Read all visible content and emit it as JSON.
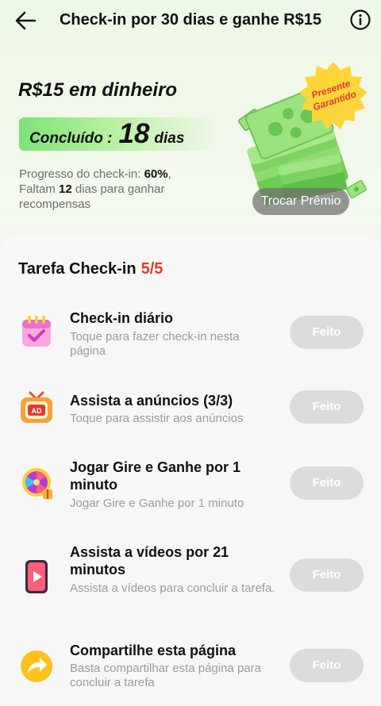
{
  "header": {
    "title": "Check-in por 30 dias e ganhe R$15"
  },
  "hero": {
    "title": "R$15 em dinheiro",
    "done_label": "Concluído :",
    "done_days": "18",
    "done_unit": "dias",
    "progress_label": "Progresso do check-in: ",
    "progress_value": "60%",
    "remaining_prefix": "Faltam ",
    "remaining_days": "12",
    "remaining_suffix": " dias para ganhar recompensas",
    "badge_line1": "Presente",
    "badge_line2": "Garantido",
    "swap_button": "Trocar Prêmio"
  },
  "tasks_section": {
    "title": "Tarefa Check-in",
    "count": "5/5",
    "tasks": [
      {
        "name": "Check-in diário",
        "desc": "Toque para fazer check-in nesta página",
        "button": "Feito",
        "icon": "calendar-icon"
      },
      {
        "name": "Assista a anúncios  (3/3)",
        "desc": "Toque para assistir aos anúncios",
        "button": "Feito",
        "icon": "tv-ad-icon"
      },
      {
        "name": "Jogar Gire e Ganhe por 1 minuto",
        "desc": "Jogar Gire e Ganhe por 1 minuto",
        "button": "Feito",
        "icon": "prize-wheel-icon"
      },
      {
        "name": "Assista a vídeos por 21 minutos",
        "desc": "Assista a vídeos para concluir a tarefa.",
        "button": "Feito",
        "icon": "video-player-icon"
      },
      {
        "name": "Compartilhe esta página",
        "desc": "Basta compartilhar esta página para concluir a tarefa",
        "button": "Feito",
        "icon": "share-icon"
      }
    ]
  },
  "colors": {
    "accent_red": "#e23b2e",
    "done_button": "#dcdcdc",
    "pill_green": "#7ee27a",
    "badge_yellow": "#ffd63a"
  }
}
